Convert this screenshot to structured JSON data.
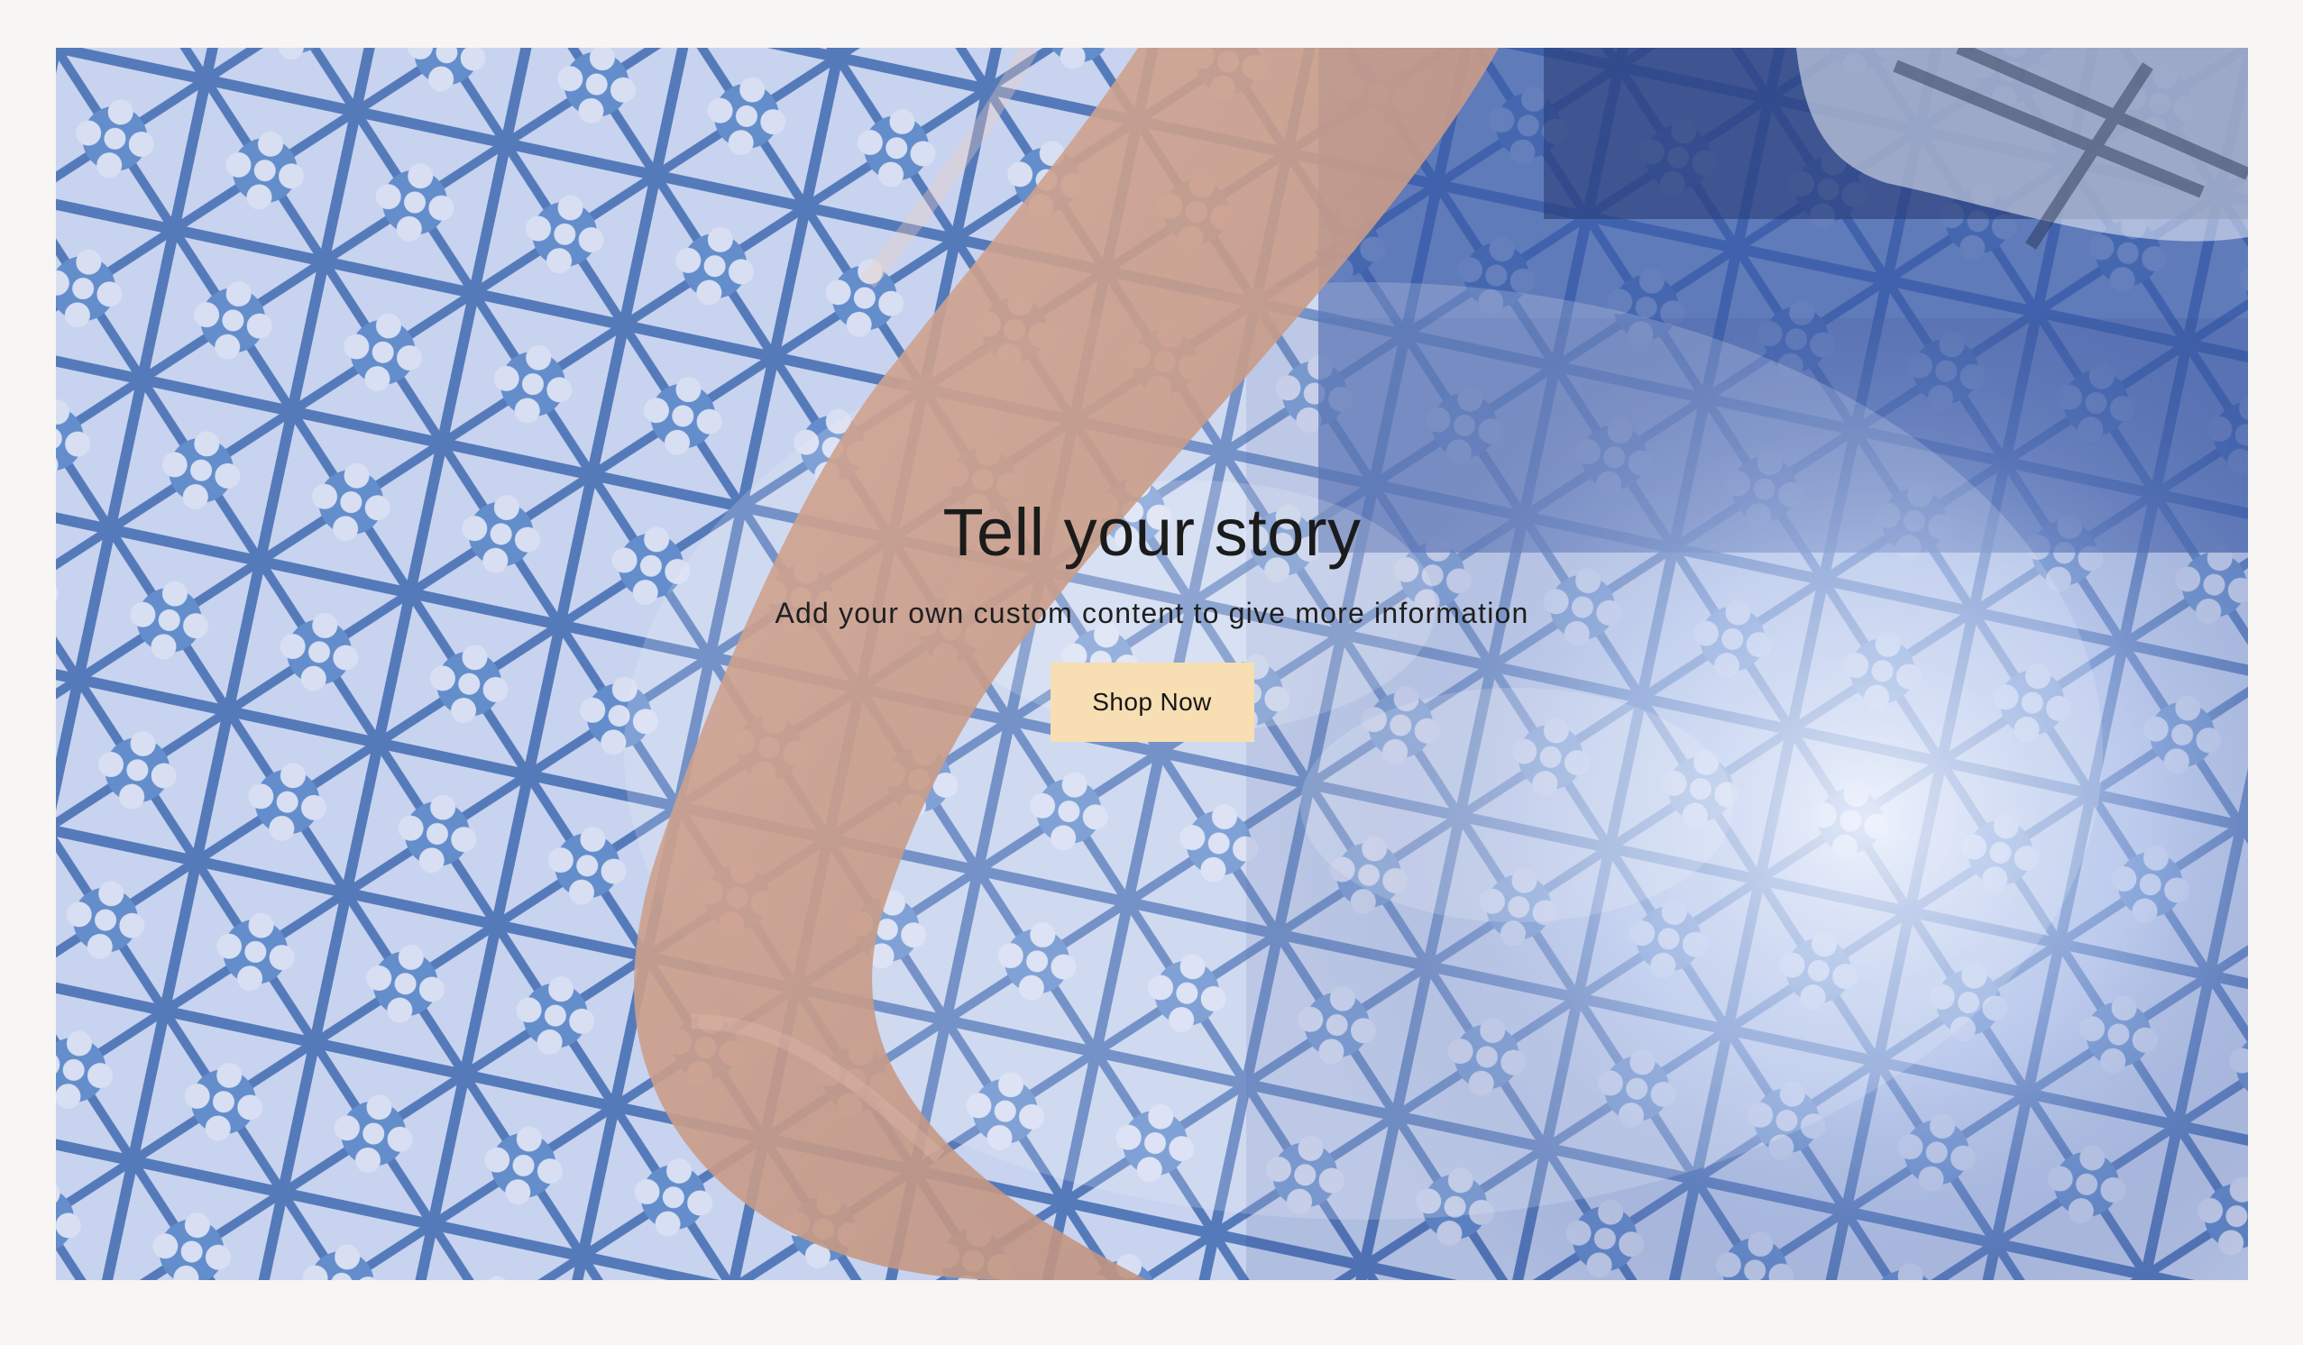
{
  "hero": {
    "title": "Tell your story",
    "subtitle": "Add your own custom content to give more information",
    "button_label": "Shop Now",
    "colors": {
      "page_background": "#f7f6f4",
      "button_background": "#f7deb3",
      "text": "#1b1b1b",
      "tile_blue": "#3f6fb4",
      "water_dark": "#1f3f95"
    }
  }
}
